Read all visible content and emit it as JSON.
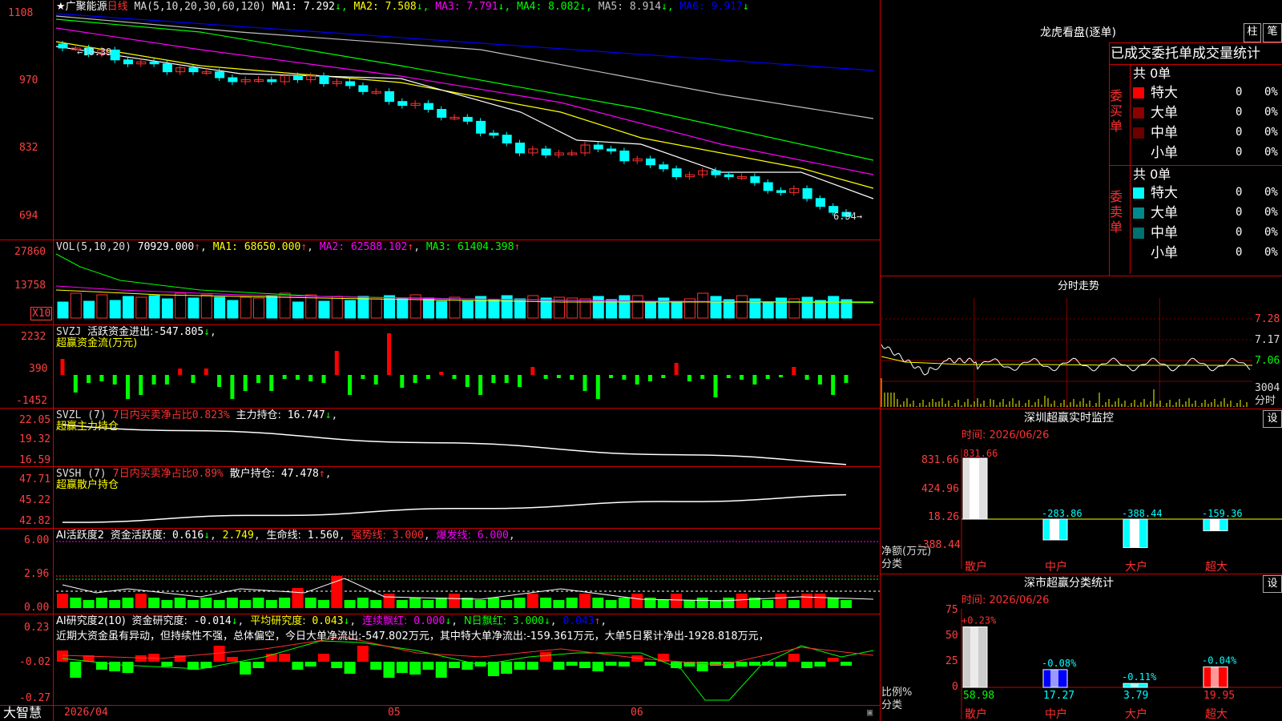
{
  "stock": {
    "star": "★",
    "name": "广聚能源",
    "period": "日线"
  },
  "ma_header": {
    "label": "MA(5,10,20,30,60,120)",
    "items": [
      {
        "name": "MA1:",
        "value": "7.292",
        "color": "#ffffff"
      },
      {
        "name": "MA2:",
        "value": "7.508",
        "color": "#ffff00"
      },
      {
        "name": "MA3:",
        "value": "7.791",
        "color": "#ff00ff"
      },
      {
        "name": "MA4:",
        "value": "8.082",
        "color": "#00ff00"
      },
      {
        "name": "MA5:",
        "value": "8.914",
        "color": "#c0c0c0"
      },
      {
        "name": "MA6:",
        "value": "9.917",
        "color": "#0000ff"
      }
    ],
    "arrow": "↓"
  },
  "price_axis": [
    "1108",
    "970",
    "832",
    "694"
  ],
  "price_annotations": {
    "high": "10.39",
    "low": "6.94"
  },
  "vol": {
    "label": "VOL(5,10,20)",
    "value": "70929.000",
    "ma1_label": "MA1:",
    "ma1": "68650.000",
    "ma2_label": "MA2:",
    "ma2": "62588.102",
    "ma3_label": "MA3:",
    "ma3": "61404.398",
    "axis": [
      "27860",
      "13758"
    ],
    "unit": "X10"
  },
  "svzj": {
    "label": "SVZJ",
    "desc": "活跃资金进出:",
    "value": "-547.805",
    "sub": "超赢资金流(万元)",
    "axis": [
      "2232",
      "390",
      "-1452"
    ]
  },
  "svzl": {
    "label": "SVZL (7)",
    "desc": "7日内买卖净占比",
    "pct": "0.823%",
    "hold_label": "主力持仓:",
    "hold": "16.747",
    "sub": "超赢主力持仓",
    "axis": [
      "22.05",
      "19.32",
      "16.59"
    ]
  },
  "svsh": {
    "label": "SVSH (7)",
    "desc": "7日内买卖净占比",
    "pct": "0.89%",
    "hold_label": "散户持仓:",
    "hold": "47.478",
    "sub": "超赢散户持仓",
    "axis": [
      "47.71",
      "45.22",
      "42.82"
    ]
  },
  "ai_active": {
    "label": "AI活跃度2",
    "desc": "资金活跃度:",
    "v1": "0.616",
    "v2": "2.749",
    "life_label": "生命线:",
    "life": "1.560",
    "strong_label": "强势线:",
    "strong": "3.000",
    "burst_label": "爆发线:",
    "burst": "6.000",
    "axis": [
      "6.00",
      "2.96",
      "0.00"
    ]
  },
  "ai_research": {
    "label": "AI研究度2(10)",
    "desc": "资金研究度:",
    "v1": "-0.014",
    "avg_label": "平均研究度:",
    "avg": "0.043",
    "red_label": "连续飘红:",
    "red": "0.000",
    "nred_label": "N日飘红:",
    "nred": "3.000",
    "v5": "0.043",
    "comment": "近期大资金虽有异动，但持续性不强，总体偏空，今日大单净流出:-547.802万元，其中特大单净流出:-159.361万元，大单5日累计净出-1928.818万元，",
    "axis": [
      "0.23",
      "-0.02",
      "-0.27"
    ]
  },
  "date_axis": [
    "2026/04",
    "05",
    "06"
  ],
  "brand": "大智慧",
  "right": {
    "dragon_title": "龙虎看盘(逐单)",
    "btn_zhu": "柱",
    "btn_bi": "笔",
    "table_header": "已成交委托单成交量统计",
    "buy_side": "委买单",
    "sell_side": "委卖单",
    "buy_total": "共 0单",
    "sell_total": "共 0单",
    "buy_rows": [
      {
        "label": "特大",
        "count": "0",
        "pct": "0%",
        "color": "#ff0000"
      },
      {
        "label": "大单",
        "count": "0",
        "pct": "0%",
        "color": "#8b0000"
      },
      {
        "label": "中单",
        "count": "0",
        "pct": "0%",
        "color": "#6b0000"
      },
      {
        "label": "小单",
        "count": "0",
        "pct": "0%",
        "color": "#000000"
      }
    ],
    "sell_rows": [
      {
        "label": "特大",
        "count": "0",
        "pct": "0%",
        "color": "#00ffff"
      },
      {
        "label": "大单",
        "count": "0",
        "pct": "0%",
        "color": "#008b8b"
      },
      {
        "label": "中单",
        "count": "0",
        "pct": "0%",
        "color": "#007070"
      },
      {
        "label": "小单",
        "count": "0",
        "pct": "0%",
        "color": "#000000"
      }
    ],
    "intraday_title": "分时走势",
    "intraday_axis": [
      "7.28",
      "7.17",
      "7.06",
      "3004",
      "分时"
    ],
    "sz_monitor": {
      "title": "深圳超赢实时监控",
      "btn": "设",
      "time": "时间: 2026/06/26",
      "axis": [
        "831.66",
        "424.96",
        "18.26",
        "-388.44"
      ],
      "ylabel": "净额(万元)",
      "xlabel": "分类",
      "bars": [
        {
          "cat": "散户",
          "value": 831.66,
          "label": "831.66"
        },
        {
          "cat": "中户",
          "value": -283.86,
          "label": "-283.86"
        },
        {
          "cat": "大户",
          "value": -388.44,
          "label": "-388.44"
        },
        {
          "cat": "超大",
          "value": -159.36,
          "label": "-159.36"
        }
      ]
    },
    "sz_classify": {
      "title": "深市超赢分类统计",
      "btn": "设",
      "time": "时间: 2026/06/26",
      "axis": [
        "75",
        "50",
        "25",
        "0"
      ],
      "ylabel": "比例%",
      "xlabel": "分类",
      "bars": [
        {
          "cat": "散户",
          "value": 58.98,
          "label": "58.98",
          "delta": "+0.23%",
          "color": "#cccccc"
        },
        {
          "cat": "中户",
          "value": 17.27,
          "label": "17.27",
          "delta": "-0.08%",
          "color": "#0000ff"
        },
        {
          "cat": "大户",
          "value": 3.79,
          "label": "3.79",
          "delta": "-0.11%",
          "color": "#00ffff"
        },
        {
          "cat": "超大",
          "value": 19.95,
          "label": "19.95",
          "delta": "-0.04%",
          "color": "#ff0000"
        }
      ]
    }
  }
}
